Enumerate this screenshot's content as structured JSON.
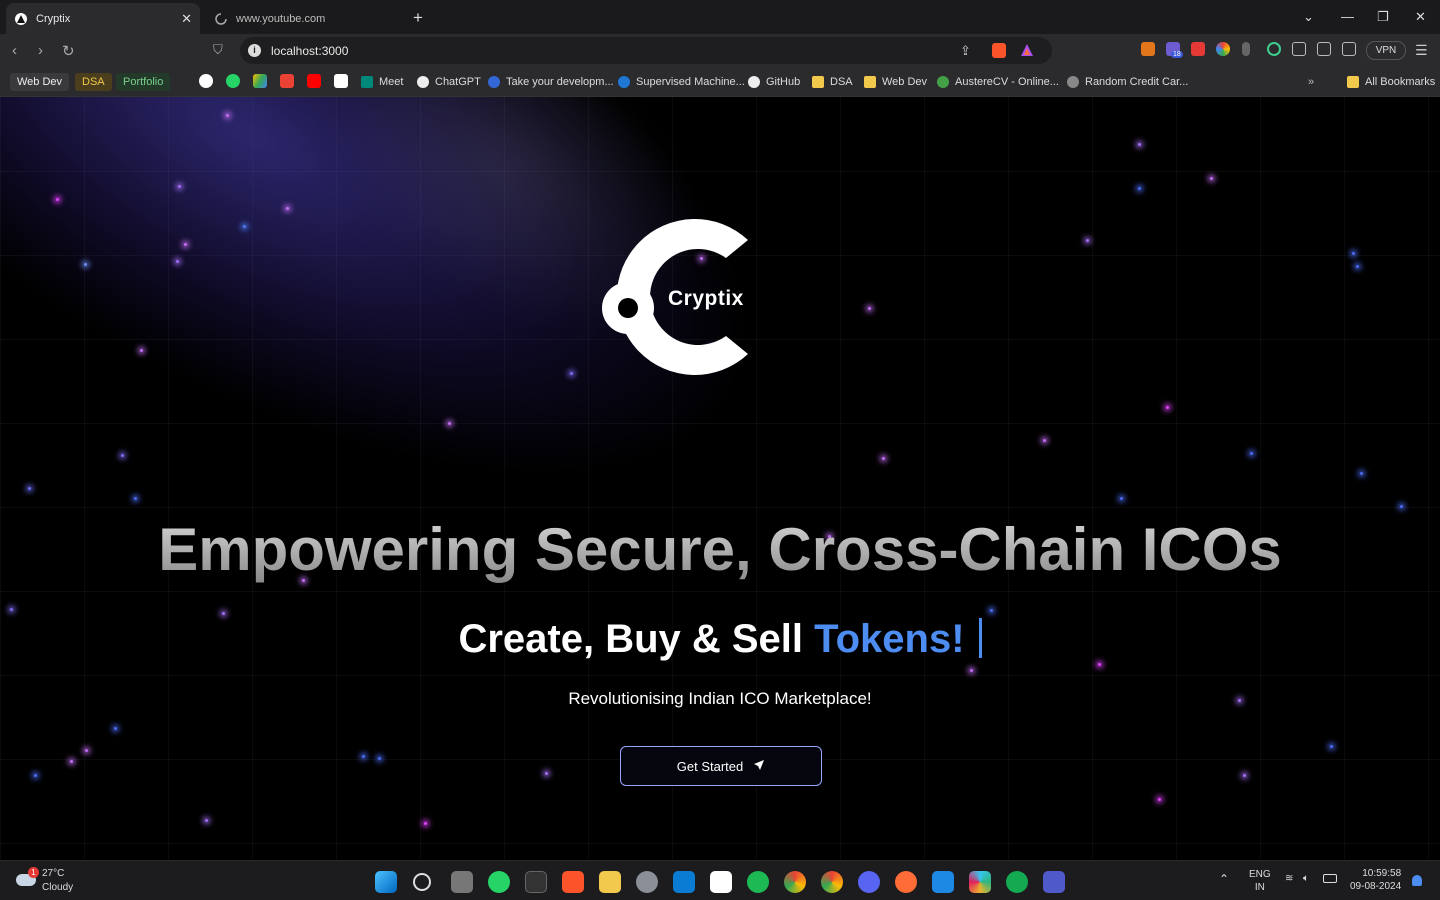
{
  "browser": {
    "tabs": [
      {
        "title": "Cryptix",
        "active": true
      },
      {
        "title": "www.youtube.com",
        "active": false
      }
    ],
    "new_tab": "+",
    "url": "localhost:3000",
    "vpn_label": "VPN",
    "extension_badge": "18",
    "bookmarks": [
      {
        "label": "Web Dev",
        "style": "chip"
      },
      {
        "label": "DSA",
        "style": "chip"
      },
      {
        "label": "Portfolio",
        "style": "chip"
      },
      {
        "label": "Meet"
      },
      {
        "label": "ChatGPT"
      },
      {
        "label": "Take your developm..."
      },
      {
        "label": "Supervised Machine..."
      },
      {
        "label": "GitHub"
      },
      {
        "label": "DSA"
      },
      {
        "label": "Web Dev"
      },
      {
        "label": "AustereCV - Online..."
      },
      {
        "label": "Random Credit Car..."
      },
      {
        "label": "All Bookmarks"
      }
    ]
  },
  "hero": {
    "logo_text": "Cryptix",
    "headline": "Empowering Secure, Cross-Chain ICOs",
    "subhead_prefix": "Create, Buy & Sell ",
    "subhead_accent": "Tokens!",
    "tagline": "Revolutionising Indian ICO Marketplace!",
    "cta_label": "Get Started"
  },
  "taskbar": {
    "weather_temp": "27°C",
    "weather_desc": "Cloudy",
    "weather_badge": "1",
    "lang_line1": "ENG",
    "lang_line2": "IN",
    "time": "10:59:58",
    "date": "09-08-2024"
  },
  "colors": {
    "accent": "#4d8cf0",
    "cta_border": "#9aa4ff",
    "background": "#000000"
  }
}
